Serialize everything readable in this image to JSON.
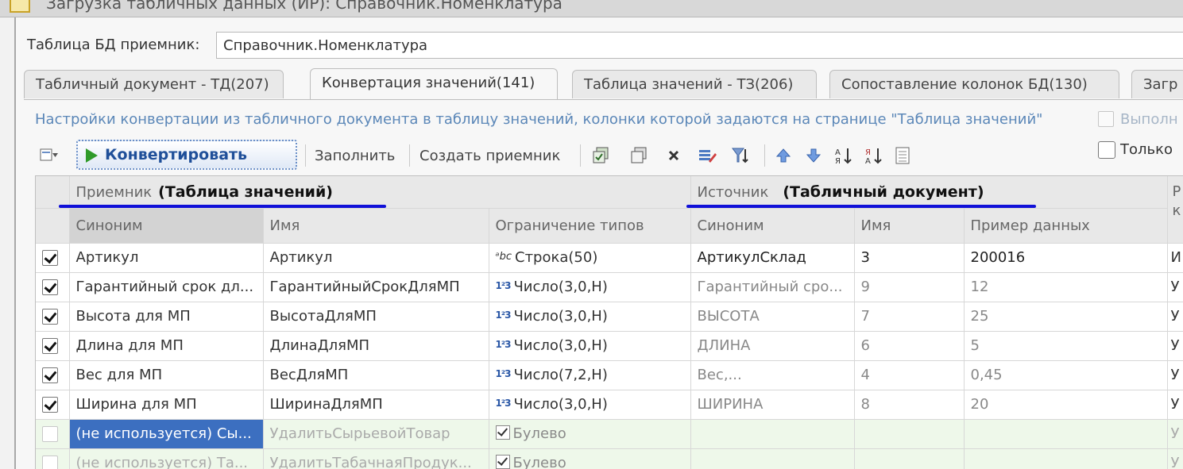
{
  "window": {
    "title": "Загрузка табличных данных (ИР): Справочник.Номенклатура"
  },
  "db_table": {
    "label": "Таблица БД приемник:",
    "value": "Справочник.Номенклатура"
  },
  "tabs": [
    {
      "label": "Табличный документ - ТД(207)",
      "active": false
    },
    {
      "label": "Конвертация значений(141)",
      "active": true
    },
    {
      "label": "Таблица значений - ТЗ(206)",
      "active": false
    },
    {
      "label": "Сопоставление колонок БД(130)",
      "active": false
    },
    {
      "label": "Загр",
      "active": false
    }
  ],
  "hint": {
    "text": "Настройки конвертации из табличного документа в таблицу значений, колонки которой задаются на странице \"Таблица значений\"",
    "check_label": "Выполн"
  },
  "toolbar": {
    "convert_label": "Конвертировать",
    "fill_label": "Заполнить",
    "create_label": "Создать приемник",
    "only_label": "Только"
  },
  "grid": {
    "group_receiver": "Приемник",
    "group_receiver_annot": "(Таблица значений)",
    "group_source": "Источник",
    "group_source_annot": "(Табличный документ)",
    "group_extra": "Р",
    "group_extra_line2": "к",
    "columns": {
      "syn": "Синоним",
      "name": "Имя",
      "types": "Ограничение типов",
      "src_syn": "Синоним",
      "src_name": "Имя",
      "sample": "Пример данных"
    },
    "rows": [
      {
        "checked": true,
        "syn": "Артикул",
        "name": "Артикул",
        "type_icon": "abc",
        "type": "Строка(50)",
        "src_syn": "АртикулСклад",
        "src_name": "3",
        "sample": "200016",
        "extra": "И"
      },
      {
        "checked": true,
        "syn": "Гарантийный срок дл...",
        "name": "ГарантийныйСрокДляМП",
        "type_icon": "123",
        "type": "Число(3,0,Н)",
        "src_syn": "Гарантийный сро...",
        "src_name": "9",
        "sample": "12",
        "extra": "У"
      },
      {
        "checked": true,
        "syn": "Высота для МП",
        "name": "ВысотаДляМП",
        "type_icon": "123",
        "type": "Число(3,0,Н)",
        "src_syn": "ВЫСОТА",
        "src_name": "7",
        "sample": "25",
        "extra": "У"
      },
      {
        "checked": true,
        "syn": "Длина для МП",
        "name": "ДлинаДляМП",
        "type_icon": "123",
        "type": "Число(3,0,Н)",
        "src_syn": "ДЛИНА",
        "src_name": "6",
        "sample": "5",
        "extra": "У"
      },
      {
        "checked": true,
        "syn": "Вес для МП",
        "name": "ВесДляМП",
        "type_icon": "123",
        "type": "Число(7,2,Н)",
        "src_syn": "Вес,...",
        "src_name": "4",
        "sample": "0,45",
        "extra": "У"
      },
      {
        "checked": true,
        "syn": "Ширина для МП",
        "name": "ШиринаДляМП",
        "type_icon": "123",
        "type": "Число(3,0,Н)",
        "src_syn": "ШИРИНА",
        "src_name": "8",
        "sample": "20",
        "extra": "У"
      },
      {
        "checked": false,
        "syn": "(не используется) Сы...",
        "name": "УдалитьСырьевойТовар",
        "type_icon": "bool",
        "type": "Булево",
        "src_syn": "",
        "src_name": "",
        "sample": "",
        "extra": "У"
      },
      {
        "checked": false,
        "syn": "(не используется) Та...",
        "name": "УдалитьТабачнаяПродук...",
        "type_icon": "bool",
        "type": "Булево",
        "src_syn": "",
        "src_name": "",
        "sample": "",
        "extra": "У"
      }
    ]
  },
  "colors": {
    "accent": "#1f4f99",
    "annotation_line": "#1010d8",
    "selection": "#3c6fc0",
    "unused_row": "#eef8ea",
    "hint": "#5b87b8"
  }
}
